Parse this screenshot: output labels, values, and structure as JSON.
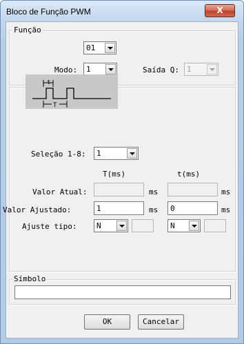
{
  "window": {
    "title": "Bloco de Função PWM",
    "close_glyph": "X"
  },
  "funcao": {
    "legend": "Função",
    "number_value": "01",
    "modo_label": "Modo:",
    "modo_value": "1",
    "saida_label": "Saída Q:",
    "saida_value": "1"
  },
  "params": {
    "selecao_label": "Seleção 1-8:",
    "selecao_value": "1",
    "col_T": "T(ms)",
    "col_t": "t(ms)",
    "valor_atual_label": "Valor Atual:",
    "valor_atual_T": "",
    "valor_atual_t": "",
    "unit_ms": "ms",
    "valor_ajustado_label": "Valor Ajustado:",
    "valor_ajustado_T": "1",
    "valor_ajustado_t": "0",
    "ajuste_label": "Ajuste tipo:",
    "ajuste_T": "N",
    "ajuste_t": "N"
  },
  "diagram": {
    "label_t": "t",
    "label_T": "T"
  },
  "simbolo": {
    "legend": "Símbolo",
    "value": ""
  },
  "buttons": {
    "ok": "OK",
    "cancel": "Cancelar"
  }
}
